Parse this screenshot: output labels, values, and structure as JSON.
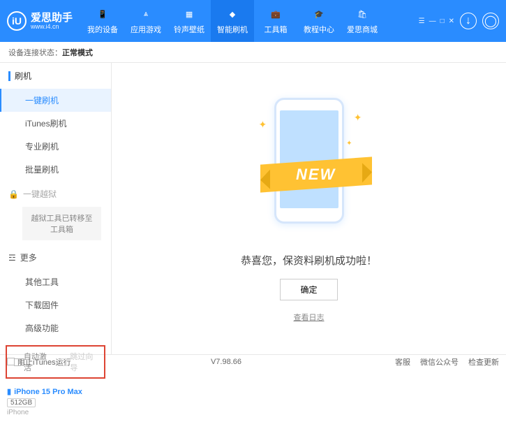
{
  "header": {
    "logo_letter": "iU",
    "title": "爱思助手",
    "url": "www.i4.cn",
    "nav": [
      {
        "label": "我的设备"
      },
      {
        "label": "应用游戏"
      },
      {
        "label": "铃声壁纸"
      },
      {
        "label": "智能刷机"
      },
      {
        "label": "工具箱"
      },
      {
        "label": "教程中心"
      },
      {
        "label": "爱思商城"
      }
    ]
  },
  "status": {
    "prefix": "设备连接状态：",
    "value": "正常模式"
  },
  "sidebar": {
    "section_flash": "刷机",
    "items_flash": [
      "一键刷机",
      "iTunes刷机",
      "专业刷机",
      "批量刷机"
    ],
    "section_jail": "一键越狱",
    "jail_note": "越狱工具已转移至工具箱",
    "section_more": "更多",
    "items_more": [
      "其他工具",
      "下载固件",
      "高级功能"
    ],
    "check_auto": "自动激活",
    "check_skip": "跳过向导",
    "device": {
      "name": "iPhone 15 Pro Max",
      "storage": "512GB",
      "type": "iPhone"
    }
  },
  "main": {
    "ribbon": "NEW",
    "success": "恭喜您，保资料刷机成功啦！",
    "ok": "确定",
    "log": "查看日志"
  },
  "footer": {
    "block_itunes": "阻止iTunes运行",
    "version": "V7.98.66",
    "links": [
      "客服",
      "微信公众号",
      "检查更新"
    ]
  }
}
